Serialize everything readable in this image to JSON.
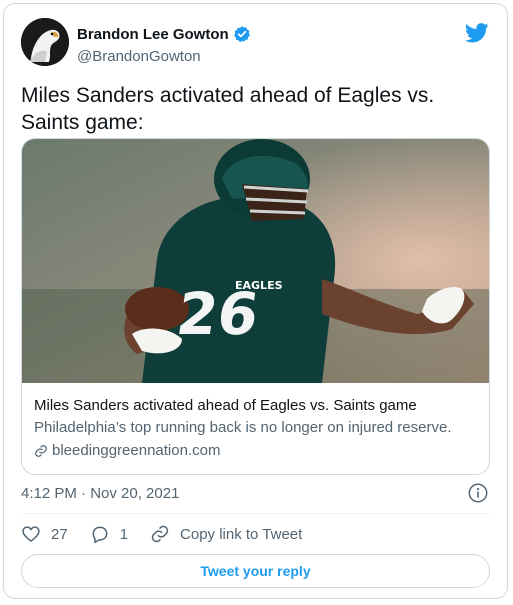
{
  "author": {
    "display_name": "Brandon Lee Gowton",
    "handle": "@BrandonGowton",
    "verified": true,
    "avatar_icon": "eagle-avatar"
  },
  "tweet": {
    "text": "Miles Sanders activated ahead of Eagles vs. Saints game:",
    "timestamp": "4:12 PM · Nov 20, 2021"
  },
  "card": {
    "title": "Miles Sanders activated ahead of Eagles vs. Saints game",
    "description": "Philadelphia’s top running back is no longer on injured reserve.",
    "domain": "bleedinggreennation.com",
    "image_icon": "football-player-photo"
  },
  "actions": {
    "likes": "27",
    "replies": "1",
    "copy_link_label": "Copy link to Tweet"
  },
  "reply_button_label": "Tweet your reply",
  "colors": {
    "accent": "#1d9bf0",
    "text": "#0f1419",
    "muted": "#536471",
    "border": "#cfd9de"
  }
}
